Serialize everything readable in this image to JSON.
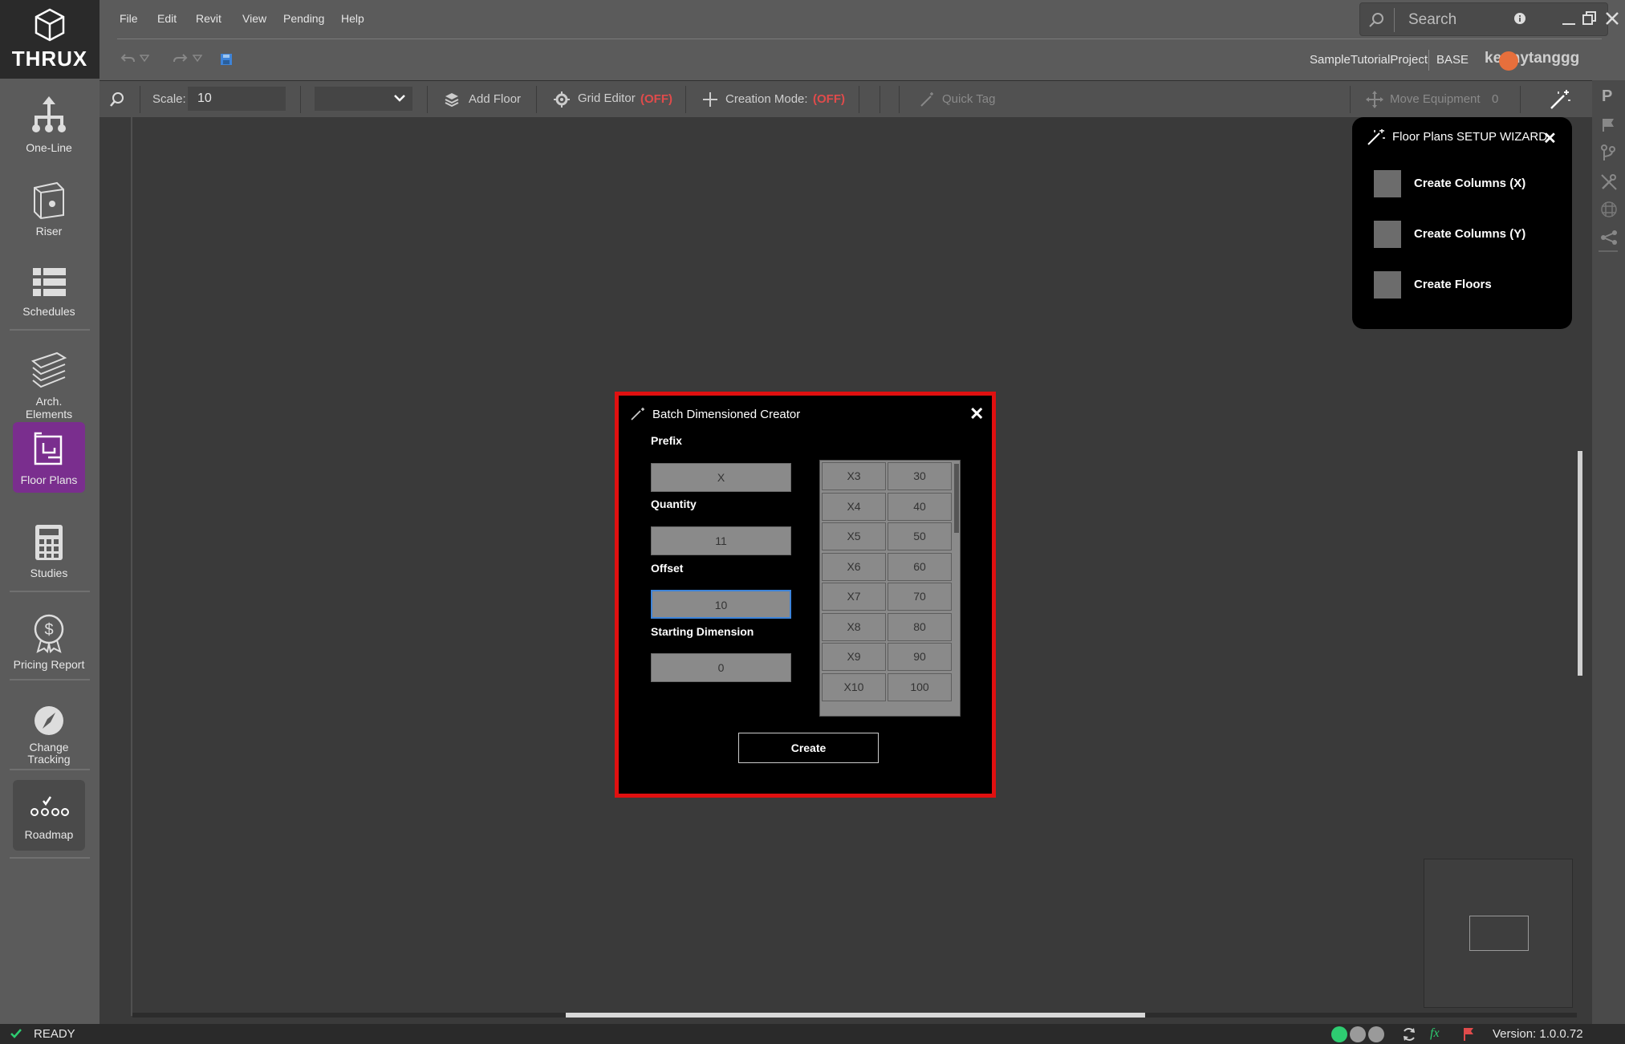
{
  "app": {
    "logo": "THRUX",
    "menu": [
      "File",
      "Edit",
      "Revit",
      "View",
      "Pending",
      "Help"
    ],
    "search": {
      "placeholder": "Search"
    },
    "project": "SampleTutorialProject",
    "branch": "BASE",
    "user": "kennytanggg"
  },
  "sidebar": {
    "items": [
      {
        "label": "One-Line",
        "icon": "hierarchy-icon"
      },
      {
        "label": "Riser",
        "icon": "cube-icon"
      },
      {
        "label": "Schedules",
        "icon": "list-icon"
      },
      {
        "label": "Arch. Elements",
        "icon": "layers-icon"
      },
      {
        "label": "Floor Plans",
        "icon": "map-icon"
      },
      {
        "label": "Studies",
        "icon": "calculator-icon"
      },
      {
        "label": "Pricing Report",
        "icon": "dollar-badge-icon"
      },
      {
        "label": "Change Tracking",
        "icon": "compass-icon"
      },
      {
        "label": "Roadmap",
        "icon": "roadmap-icon"
      }
    ],
    "active": "Floor Plans"
  },
  "toolbar": {
    "scale_label": "Scale:",
    "scale_value": "10",
    "add_floor": "Add Floor",
    "grid_editor": "Grid Editor",
    "grid_editor_state": "(OFF)",
    "creation_mode": "Creation Mode:",
    "creation_mode_state": "(OFF)",
    "quick_tag": "Quick Tag",
    "move_equipment": "Move Equipment",
    "move_equipment_count": "0"
  },
  "wizard": {
    "title": "Floor Plans  SETUP WIZARD",
    "items": [
      "Create Columns (X)",
      "Create Columns (Y)",
      "Create Floors"
    ]
  },
  "dialog": {
    "title": "Batch Dimensioned Creator",
    "fields": {
      "prefix_label": "Prefix",
      "prefix_value": "X",
      "quantity_label": "Quantity",
      "quantity_value": "11",
      "offset_label": "Offset",
      "offset_value": "10",
      "start_label": "Starting Dimension",
      "start_value": "0"
    },
    "rows": [
      [
        "X3",
        "30"
      ],
      [
        "X4",
        "40"
      ],
      [
        "X5",
        "50"
      ],
      [
        "X6",
        "60"
      ],
      [
        "X7",
        "70"
      ],
      [
        "X8",
        "80"
      ],
      [
        "X9",
        "90"
      ],
      [
        "X10",
        "100"
      ]
    ],
    "create_label": "Create"
  },
  "status": {
    "text": "READY",
    "version_label": "Version:",
    "version": "1.0.0.72"
  },
  "colors": {
    "accent_purple": "#7a2e8e",
    "highlight_red": "#e01010",
    "off_red": "#e04b4b",
    "status_green": "#2ecc71"
  }
}
